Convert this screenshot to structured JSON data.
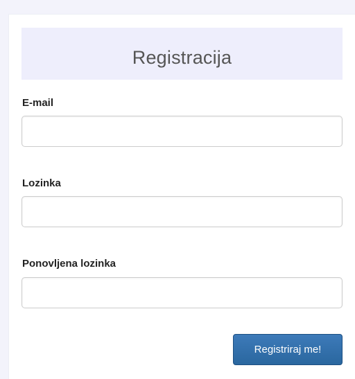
{
  "form": {
    "title": "Registracija",
    "fields": [
      {
        "label": "E-mail",
        "value": "",
        "placeholder": ""
      },
      {
        "label": "Lozinka",
        "value": "",
        "placeholder": ""
      },
      {
        "label": "Ponovljena lozinka",
        "value": "",
        "placeholder": ""
      }
    ],
    "submit_label": "Registriraj me!"
  },
  "colors": {
    "header_background": "#eeeefc",
    "button_primary": "#2a679f",
    "page_background": "#f3f3fb"
  }
}
